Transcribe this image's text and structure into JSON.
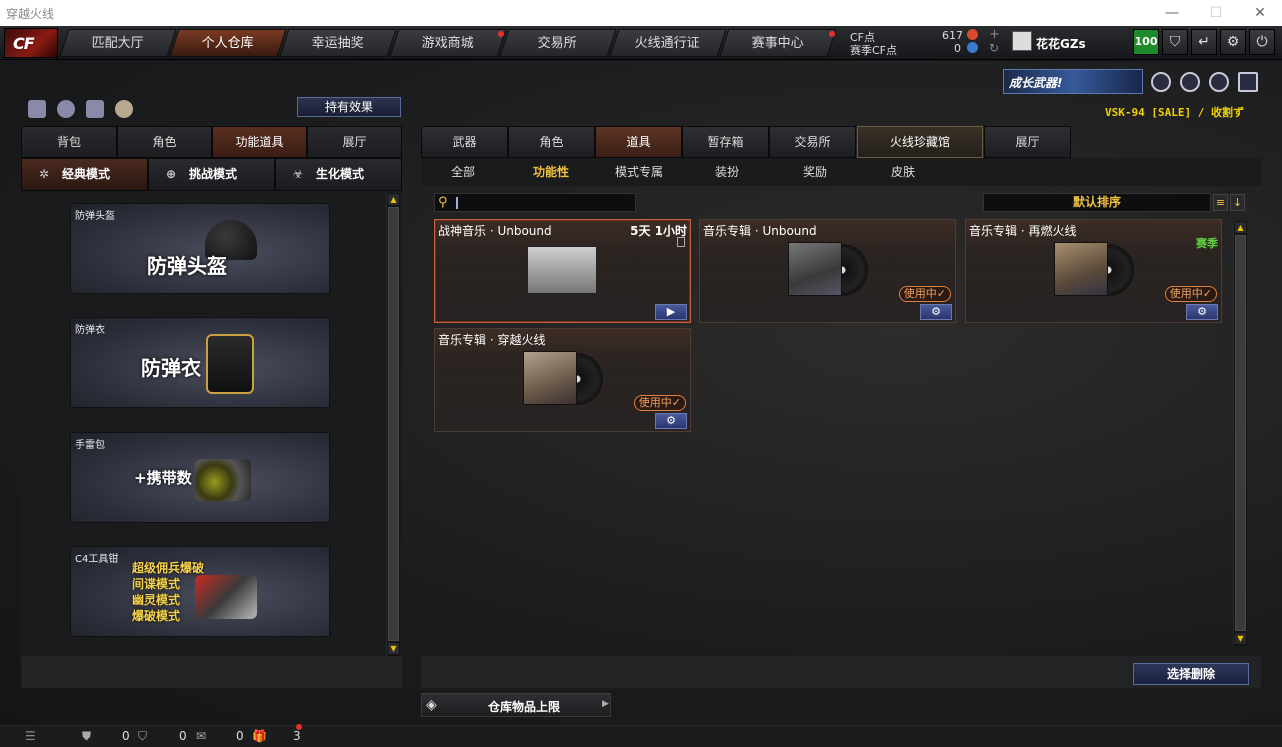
{
  "window": {
    "title": "穿越火线"
  },
  "topnav": {
    "logo": "CF",
    "tabs": [
      "匹配大厅",
      "个人仓库",
      "幸运抽奖",
      "游戏商城",
      "交易所",
      "火线通行证",
      "赛事中心"
    ],
    "active_tab": "个人仓库",
    "cf_label": "CF点",
    "cf_value": "617",
    "season_cf_label": "赛季CF点",
    "season_cf_value": "0",
    "username": "花花GZs",
    "badge_value": "100"
  },
  "banner": {
    "text": "成长武器!",
    "promo": "VSK-94 [SALE] / 收割ず"
  },
  "left": {
    "effect_button": "持有效果",
    "tabs": [
      "背包",
      "角色",
      "功能道具",
      "展厅"
    ],
    "active_tab": "功能道具",
    "modes": [
      "经典模式",
      "挑战模式",
      "生化模式"
    ],
    "active_mode": "经典模式",
    "cards": [
      {
        "caption": "防弹头盔",
        "title": "防弹头盔"
      },
      {
        "caption": "防弹衣",
        "title": "防弹衣"
      },
      {
        "caption": "手雷包",
        "title": "+携带数"
      },
      {
        "caption": "C4工具钳",
        "lines": [
          "超级佣兵爆破",
          "间谍模式",
          "幽灵模式",
          "爆破模式"
        ]
      }
    ]
  },
  "right": {
    "tabs": [
      "武器",
      "角色",
      "道具",
      "暂存箱",
      "交易所",
      "火线珍藏馆",
      "展厅"
    ],
    "active_tab": "道具",
    "subtabs": [
      "全部",
      "功能性",
      "模式专属",
      "装扮",
      "奖励",
      "皮肤"
    ],
    "active_subtab": "功能性",
    "search": {
      "value": ""
    },
    "sort_label": "默认排序",
    "items": [
      {
        "name": "战神音乐 · Unbound",
        "time": "5天 1小时",
        "selected": true,
        "button": "▶"
      },
      {
        "name": "音乐专辑 · Unbound",
        "status": "使用中✓",
        "button": "⚙"
      },
      {
        "name": "音乐专辑 · 再燃火线",
        "tag": "赛季",
        "status": "使用中✓",
        "button": "⚙"
      },
      {
        "name": "音乐专辑 · 穿越火线",
        "status": "使用中✓",
        "button": "⚙"
      }
    ],
    "delete_button": "选择删除",
    "limit_button": "仓库物品上限"
  },
  "status": {
    "a": "0",
    "b": "0",
    "c": "0",
    "d": "3"
  }
}
